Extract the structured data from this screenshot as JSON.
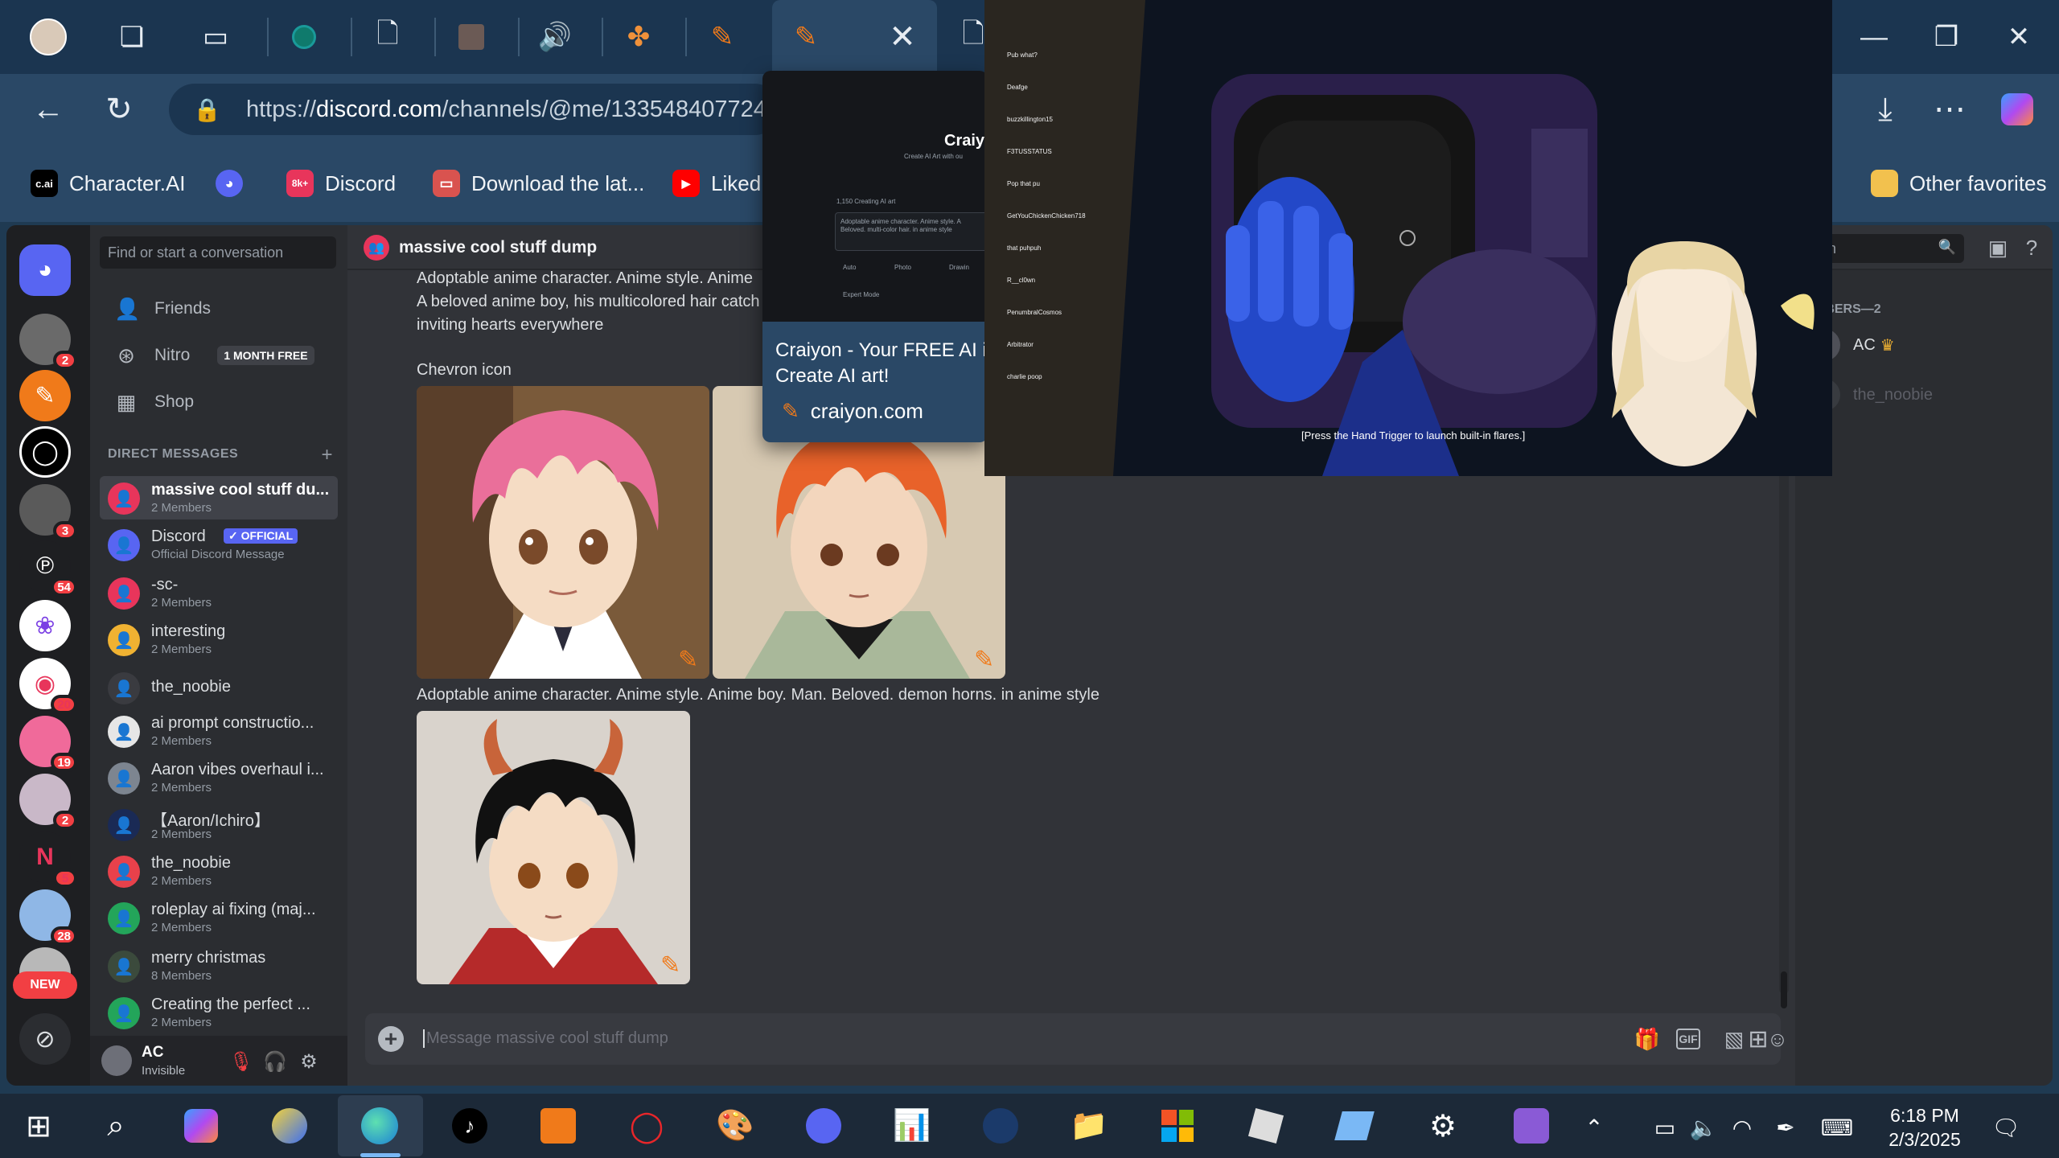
{
  "browser": {
    "url_prefix": "https://",
    "url_host": "discord.com",
    "url_path": "/channels/@me/1335484077247",
    "favorites": [
      {
        "label": "Character.AI",
        "icon": "c.ai",
        "color": "#000000"
      },
      {
        "label": "",
        "icon": "discord-icon",
        "color": "#5865f2"
      },
      {
        "label": "Discord",
        "icon": "8k+",
        "color": "#e8355b"
      },
      {
        "label": "Download the lat...",
        "icon": "download-icon",
        "color": "#d9534f"
      },
      {
        "label": "Liked",
        "icon": "youtube-icon",
        "color": "#ff0000"
      },
      {
        "label": "Other favorites",
        "icon": "folder-icon",
        "color": "#f2c14e"
      }
    ]
  },
  "tab_popup": {
    "title": "Craiyon - Your FREE AI in Create AI art!",
    "title_line1": "Craiyon - Your FREE AI in",
    "title_line2": "Create AI art!",
    "url": "craiyon.com",
    "thumb_title": "Craiy",
    "thumb_sub": "Create AI Art with ou",
    "thumb_count": "1,150 Creating AI art",
    "thumb_prompt": "Adoptable anime character. Anime style. A Beloved. multi-color hair. in anime style",
    "thumb_tabs": [
      "Auto",
      "Photo",
      "Drawin"
    ],
    "thumb_expert": "Expert Mode"
  },
  "video": {
    "caption": "[Press the Hand Trigger to launch built-in flares.]",
    "screen_text": "...dark areas...",
    "chat_lines": [
      "Pub what?",
      "Deafge",
      "buzzkillington15",
      "F3TUSSTATUS",
      "Pop that pu",
      "GetYouChickenChicken718",
      "that puhpuh",
      "R__cl0wn",
      "PenumbralCosmos",
      "Arbitrator",
      "charlie poop"
    ]
  },
  "discord": {
    "search_placeholder": "Find or start a conversation",
    "nav": [
      {
        "label": "Friends",
        "icon": "friends-icon"
      },
      {
        "label": "Nitro",
        "icon": "nitro-icon",
        "tag": "1 MONTH FREE"
      },
      {
        "label": "Shop",
        "icon": "shop-icon"
      }
    ],
    "dm_header": "DIRECT MESSAGES",
    "dms": [
      {
        "name": "massive cool stuff du...",
        "sub": "2 Members",
        "color": "#e8355b",
        "selected": true
      },
      {
        "name": "Discord",
        "sub": "Official Discord Message",
        "color": "#5865f2",
        "badge": "✓ OFFICIAL"
      },
      {
        "name": "-sc-",
        "sub": "2 Members",
        "color": "#e8355b"
      },
      {
        "name": "interesting",
        "sub": "2 Members",
        "color": "#f0b232"
      },
      {
        "name": "the_noobie",
        "sub": "",
        "color": "#3a3b40"
      },
      {
        "name": "ai prompt constructio...",
        "sub": "2 Members",
        "color": "#e6e6e6"
      },
      {
        "name": "Aaron vibes overhaul i...",
        "sub": "2 Members",
        "color": "#7d8590"
      },
      {
        "name": "【Aaron/Ichiro】",
        "sub": "2 Members",
        "color": "#1a2a55"
      },
      {
        "name": "the_noobie",
        "sub": "2 Members",
        "color": "#e8414b"
      },
      {
        "name": "roleplay ai fixing (maj...",
        "sub": "2 Members",
        "color": "#23a55a"
      },
      {
        "name": "merry christmas",
        "sub": "8 Members",
        "color": "#3b4a3c"
      },
      {
        "name": "Creating the perfect ...",
        "sub": "2 Members",
        "color": "#23a55a"
      }
    ],
    "user": {
      "name": "AC",
      "status": "Invisible"
    },
    "channel_title": "massive cool stuff dump",
    "header_search": "ch",
    "messages": {
      "line_top": "Adoptable anime character. Anime style. Anime",
      "line_2": "A beloved anime boy, his multicolored hair catch",
      "line_3": "inviting hearts everywhere",
      "label_chevron": "Chevron icon",
      "line_4": "Adoptable anime character. Anime style. Anime boy. Man. Beloved. demon horns. in anime style"
    },
    "members_header": "MBERS—2",
    "members": [
      {
        "name": "AC",
        "crown": "♛"
      },
      {
        "name": "the_noobie"
      }
    ],
    "composer_placeholder": "Message massive cool stuff dump",
    "guild_badges": [
      "2",
      "3",
      "54",
      "20",
      "19",
      "2",
      "5",
      "28"
    ],
    "new_label": "NEW"
  },
  "taskbar": {
    "time": "6:18 PM",
    "date": "2/3/2025"
  }
}
